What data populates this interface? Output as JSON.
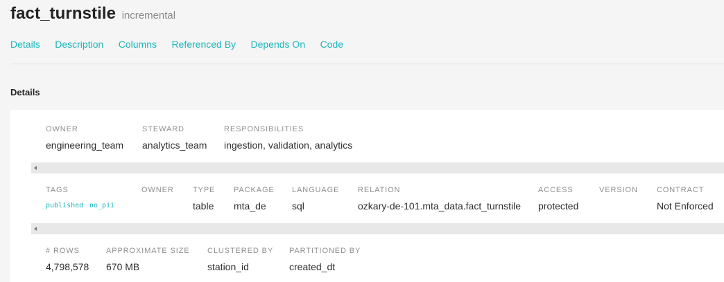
{
  "header": {
    "model_name": "fact_turnstile",
    "materialization": "incremental"
  },
  "tabs": [
    {
      "label": "Details"
    },
    {
      "label": "Description"
    },
    {
      "label": "Columns"
    },
    {
      "label": "Referenced By"
    },
    {
      "label": "Depends On"
    },
    {
      "label": "Code"
    }
  ],
  "details": {
    "section_title": "Details",
    "row1": {
      "owner": {
        "label": "OWNER",
        "value": "engineering_team"
      },
      "steward": {
        "label": "STEWARD",
        "value": "analytics_team"
      },
      "responsibilities": {
        "label": "RESPONSIBILITIES",
        "value": "ingestion, validation, analytics"
      }
    },
    "row2": {
      "tags": {
        "label": "TAGS",
        "values": [
          "published",
          "no_pii"
        ]
      },
      "owner": {
        "label": "OWNER",
        "value": ""
      },
      "type": {
        "label": "TYPE",
        "value": "table"
      },
      "package": {
        "label": "PACKAGE",
        "value": "mta_de"
      },
      "language": {
        "label": "LANGUAGE",
        "value": "sql"
      },
      "relation": {
        "label": "RELATION",
        "value": "ozkary-de-101.mta_data.fact_turnstile"
      },
      "access": {
        "label": "ACCESS",
        "value": "protected"
      },
      "version": {
        "label": "VERSION",
        "value": ""
      },
      "contract": {
        "label": "CONTRACT",
        "value": "Not Enforced"
      }
    },
    "row3": {
      "rows": {
        "label": "# ROWS",
        "value": "4,798,578"
      },
      "size": {
        "label": "APPROXIMATE SIZE",
        "value": "670 MB"
      },
      "clustered_by": {
        "label": "CLUSTERED BY",
        "value": "station_id"
      },
      "partitioned_by": {
        "label": "PARTITIONED BY",
        "value": "created_dt"
      }
    }
  },
  "icons": {
    "scroll_left": "scroll-left-arrow-icon"
  }
}
